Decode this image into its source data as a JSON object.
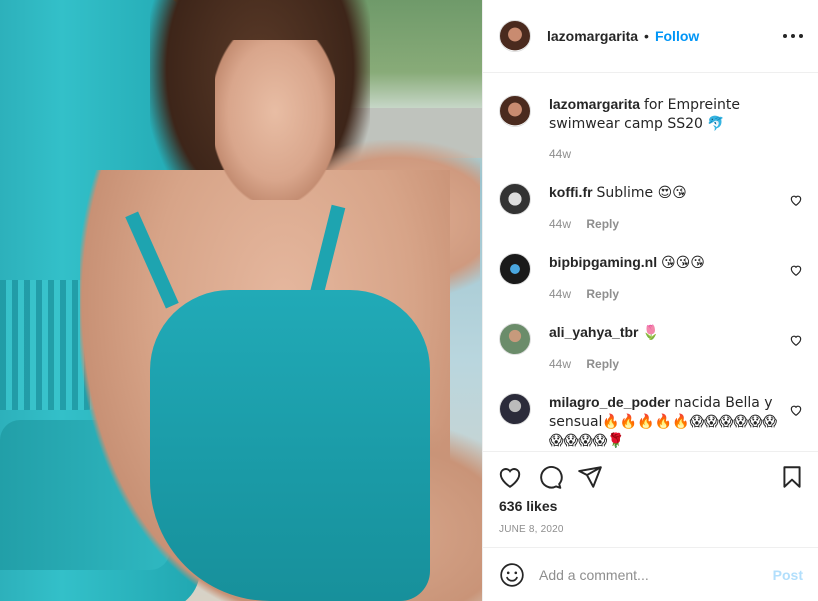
{
  "post": {
    "username": "lazomargarita",
    "follow_label": "Follow",
    "dot": "•"
  },
  "caption": {
    "username": "lazomargarita",
    "text": "for Empreinte swimwear camp SS20 🐬",
    "time": "44w"
  },
  "comments": [
    {
      "username": "koffi.fr",
      "text": "Sublime 😍😘",
      "time": "44w",
      "reply_label": "Reply"
    },
    {
      "username": "bipbipgaming.nl",
      "text": "😘😘😘",
      "time": "44w",
      "reply_label": "Reply"
    },
    {
      "username": "ali_yahya_tbr",
      "text": "🌷",
      "time": "44w",
      "reply_label": "Reply"
    },
    {
      "username": "milagro_de_poder",
      "text": "nacida Bella y sensual🔥🔥🔥🔥🔥😱😱😱😱😱😱😱😱😱😱🌹",
      "time": "",
      "reply_label": ""
    }
  ],
  "stats": {
    "likes": "636 likes",
    "date": "JUNE 8, 2020"
  },
  "composer": {
    "placeholder": "Add a comment...",
    "post_label": "Post"
  },
  "icons": {
    "like": "heart-icon",
    "comment": "comment-icon",
    "share": "share-icon",
    "save": "bookmark-icon",
    "more": "more-options-icon",
    "emoji": "emoji-icon"
  },
  "colors": {
    "accent": "#0095f6",
    "post_disabled": "#b2dffc",
    "muted": "#8e8e8e",
    "text": "#262626"
  }
}
